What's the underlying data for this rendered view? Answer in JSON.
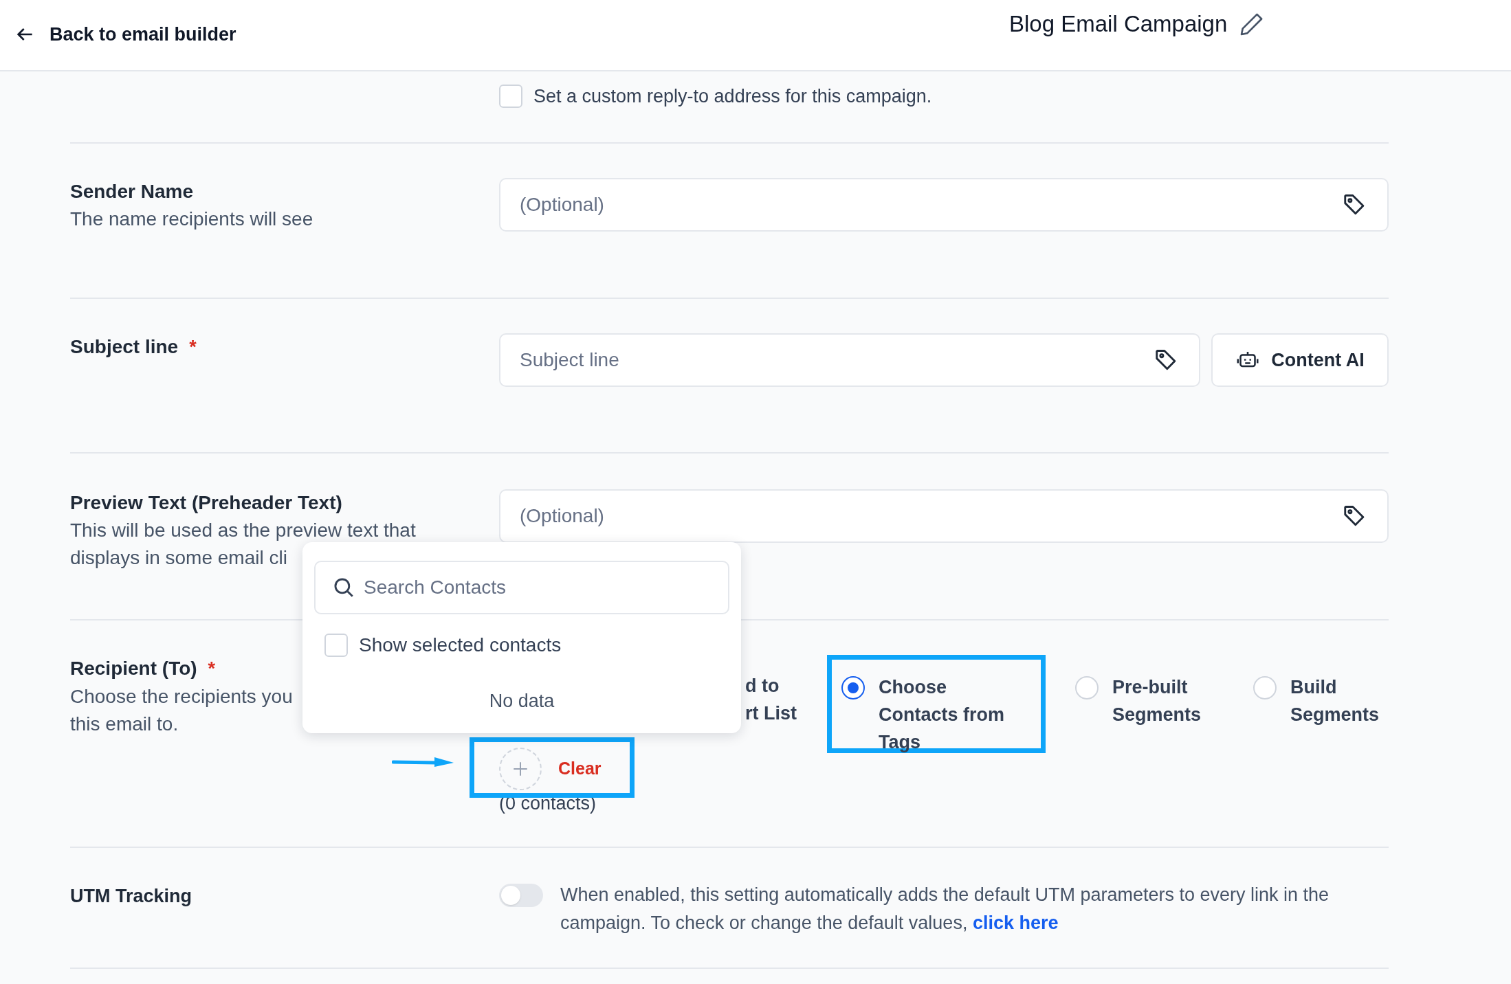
{
  "header": {
    "back_label": "Back to email builder",
    "title": "Blog Email Campaign"
  },
  "reply_to": {
    "label": "Set a custom reply-to address for this campaign.",
    "checked": false
  },
  "fields": [
    {
      "label": "Sender Name",
      "description": [
        "The name recipients will see"
      ],
      "placeholder": "(Optional)"
    },
    {
      "label": "Subject line",
      "required_mark": "*",
      "placeholder": "Subject line",
      "button": "Content AI"
    },
    {
      "label": "Preview Text (Preheader Text)",
      "description": [
        "This will be used as the preview text that",
        "displays in some email cli"
      ],
      "placeholder": "(Optional)"
    }
  ],
  "recipient": {
    "label": "Recipient (To)",
    "required_mark": "*",
    "description": [
      "Choose the recipients you",
      "this email to."
    ],
    "covered_option": [
      "d to",
      "rt List"
    ],
    "options": [
      {
        "label": "Choose Contacts from Tags",
        "selected": true,
        "highlighted": true
      },
      {
        "label": "Pre-built Segments",
        "selected": false,
        "highlighted": false
      },
      {
        "label": "Build Segments",
        "selected": false,
        "highlighted": false
      }
    ],
    "add": {
      "clear_label": "Clear",
      "count": "(0 contacts)",
      "highlighted": true
    }
  },
  "popup": {
    "search_placeholder": "Search Contacts",
    "show_selected_label": "Show selected contacts",
    "show_selected_checked": false,
    "empty_text": "No data"
  },
  "utm": {
    "label": "UTM Tracking",
    "enabled": false,
    "text": "When enabled, this setting automatically adds the default UTM parameters to every link in the campaign. To check or change the default values, ",
    "link": "click here"
  }
}
